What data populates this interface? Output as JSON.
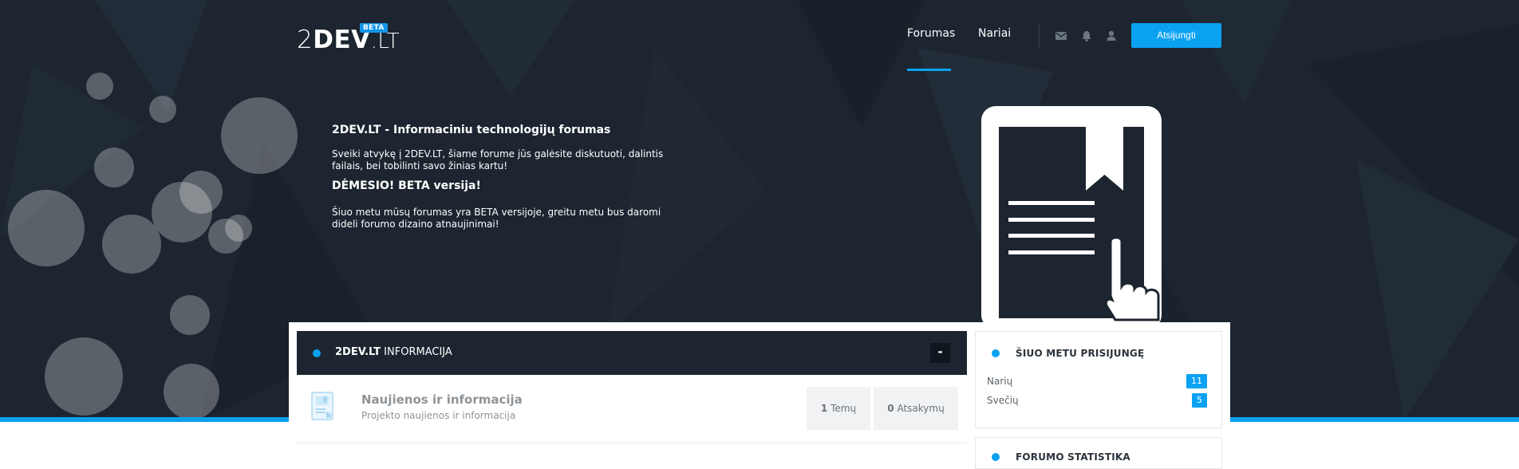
{
  "header": {
    "logo_number": "2",
    "logo_dev": "DEV",
    "logo_suffix": ".LT",
    "beta_badge": "BETA",
    "nav": [
      {
        "label": "Forumas",
        "active": true
      },
      {
        "label": "Nariai",
        "active": false
      }
    ],
    "icons": [
      "envelope-icon",
      "bell-icon",
      "user-icon"
    ],
    "connect_label": "Atsijungti"
  },
  "intro": {
    "title": "2DEV.LT - Informaciniu technologijų forumas",
    "welcome": "Sveiki atvykę į 2DEV.LT, šiame forume jūs galėsite diskutuoti, dalintis failais, bei tobilinti savo žinias kartu!",
    "notice_title": "DĖMESIO! BETA versija!",
    "notice_text": "Šiuo metu mūsų forumas yra BETA versijoje, greitu metu bus daromi dideli forumo dizaino atnaujinimai!"
  },
  "category": {
    "name_bold": "2DEV.LT",
    "name_rest": " INFORMACIJA",
    "collapse_label": "-",
    "forums": [
      {
        "title": "Naujienos ir informacija",
        "description": "Projekto naujienos ir informacija",
        "topics_count": "1",
        "topics_label": " Temų",
        "replies_count": "0",
        "replies_label": " Atsakymų"
      }
    ]
  },
  "sidebar": {
    "online": {
      "title": "ŠIUO METU PRISIJUNGĘ",
      "rows": [
        {
          "label": "Narių",
          "count": "11"
        },
        {
          "label": "Svečių",
          "count": "5"
        }
      ]
    },
    "stats": {
      "title": "FORUMO STATISTIKA"
    }
  },
  "colors": {
    "hero_bg": "#1c2530",
    "accent": "#0ba2f2"
  }
}
